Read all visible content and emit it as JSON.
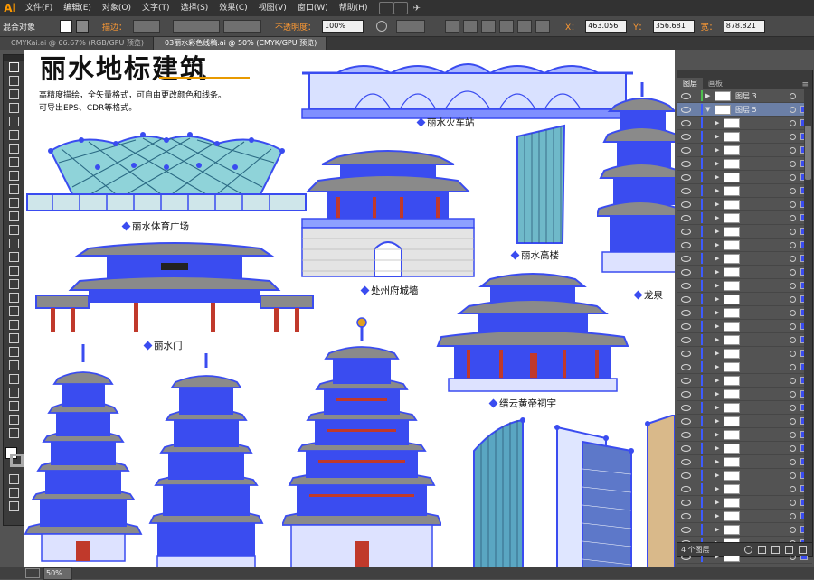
{
  "app": {
    "logo": "Ai"
  },
  "menu": [
    "文件(F)",
    "编辑(E)",
    "对象(O)",
    "文字(T)",
    "选择(S)",
    "效果(C)",
    "视图(V)",
    "窗口(W)",
    "帮助(H)"
  ],
  "control": {
    "mix_label": "混合对象",
    "stroke_label": "描边：",
    "opacity_label": "不透明度：",
    "opacity_value": "100%",
    "x_label": "X：",
    "x_value": "463.056",
    "y_label": "Y：",
    "y_value": "356.681",
    "w_label": "宽：",
    "w_value": "878.821"
  },
  "tabs": [
    {
      "label": "CMYKai.ai @ 66.67% (RGB/GPU 预览)",
      "active": false
    },
    {
      "label": "03丽水彩色线稿.ai @ 50% (CMYK/GPU 预览)",
      "active": true
    }
  ],
  "artboard": {
    "title": "丽水地标建筑",
    "line1": "高精度描绘，全矢量格式，可自由更改颜色和线条。",
    "line2": "可导出EPS、CDR等格式。",
    "captions": {
      "stadium": "丽水体育广场",
      "station": "丽水火车站",
      "cityhall": "处州府城墙",
      "tower": "丽水高楼",
      "gate": "丽水门",
      "temple": "缙云黄帝祠宇",
      "longquan": "龙泉"
    }
  },
  "layers": {
    "tab_layers": "图层",
    "tab_artboards": "画板",
    "rows": [
      {
        "name": "图层 3",
        "level": 0,
        "sel": false
      },
      {
        "name": "图层 5",
        "level": 0,
        "sel": true
      }
    ],
    "footer": "4 个图层"
  },
  "status": {
    "zoom": "50%"
  },
  "colors": {
    "selection": "#3a4cf0",
    "accent": "#ff9a00"
  }
}
